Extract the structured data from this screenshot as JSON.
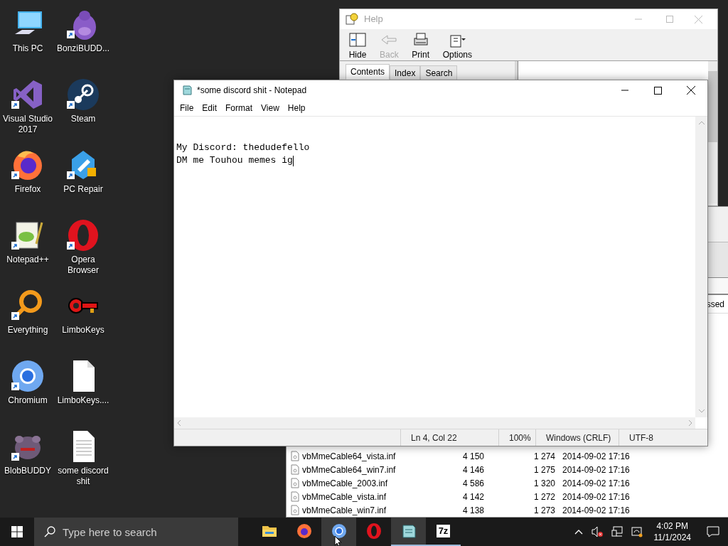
{
  "desktop_icons": [
    {
      "label": "This PC",
      "kind": "pc",
      "shortcut": false
    },
    {
      "label": "BonziBUDD...",
      "kind": "creature",
      "shortcut": true
    },
    {
      "label": "Visual Studio 2017",
      "kind": "vs",
      "shortcut": true
    },
    {
      "label": "Steam",
      "kind": "steam",
      "shortcut": true
    },
    {
      "label": "Firefox",
      "kind": "firefox",
      "shortcut": true
    },
    {
      "label": "PC Repair",
      "kind": "repair",
      "shortcut": true
    },
    {
      "label": "Notepad++",
      "kind": "notepadpp",
      "shortcut": true
    },
    {
      "label": "Opera Browser",
      "kind": "opera",
      "shortcut": true
    },
    {
      "label": "Everything",
      "kind": "magnifier",
      "shortcut": true
    },
    {
      "label": "LimboKeys",
      "kind": "key",
      "shortcut": false
    },
    {
      "label": "Chromium",
      "kind": "chromium",
      "shortcut": true
    },
    {
      "label": "LimboKeys....",
      "kind": "blank-file",
      "shortcut": false
    },
    {
      "label": "BlobBUDDY",
      "kind": "blob",
      "shortcut": true
    },
    {
      "label": "some discord shit",
      "kind": "text-file",
      "shortcut": false
    }
  ],
  "help_window": {
    "title": "Help",
    "toolbar": [
      {
        "label": "Hide",
        "kind": "hide",
        "disabled": false
      },
      {
        "label": "Back",
        "kind": "back",
        "disabled": true
      },
      {
        "label": "Print",
        "kind": "print",
        "disabled": false
      },
      {
        "label": "Options",
        "kind": "options",
        "disabled": false
      }
    ],
    "tabs": [
      {
        "label": "Contents",
        "selected": true
      },
      {
        "label": "Index",
        "selected": false
      },
      {
        "label": "Search",
        "selected": false
      }
    ]
  },
  "archive_window": {
    "column_label": "ssed",
    "rows": [
      {
        "name": "vbMmeCable64_vista.inf",
        "size": "4 150",
        "packed": "1 274",
        "modified": "2014-09-02 17:16"
      },
      {
        "name": "vbMmeCable64_win7.inf",
        "size": "4 146",
        "packed": "1 275",
        "modified": "2014-09-02 17:16"
      },
      {
        "name": "vbMmeCable_2003.inf",
        "size": "4 586",
        "packed": "1 320",
        "modified": "2014-09-02 17:16"
      },
      {
        "name": "vbMmeCable_vista.inf",
        "size": "4 142",
        "packed": "1 272",
        "modified": "2014-09-02 17:16"
      },
      {
        "name": "vbMmeCable_win7.inf",
        "size": "4 138",
        "packed": "1 273",
        "modified": "2014-09-02 17:16"
      }
    ]
  },
  "notepad": {
    "title": "*some discord shit - Notepad",
    "menu": [
      "File",
      "Edit",
      "Format",
      "View",
      "Help"
    ],
    "lines": [
      "My Discord: thedudefello",
      "DM me Touhou memes ig"
    ],
    "status_bar": [
      "Ln 4, Col 22",
      "100%",
      "Windows (CRLF)",
      "UTF-8"
    ]
  },
  "taskbar": {
    "search_placeholder": "Type here to search",
    "apps": [
      {
        "kind": "explorer",
        "running": false,
        "active": false
      },
      {
        "kind": "firefox",
        "running": false,
        "active": false
      },
      {
        "kind": "chromium",
        "running": false,
        "active": true
      },
      {
        "kind": "opera",
        "running": false,
        "active": false
      },
      {
        "kind": "notepad",
        "running": true,
        "active": true
      },
      {
        "kind": "sevenzip",
        "running": true,
        "active": false,
        "label": "7z"
      }
    ],
    "time": "4:02 PM",
    "date": "11/1/2024"
  }
}
